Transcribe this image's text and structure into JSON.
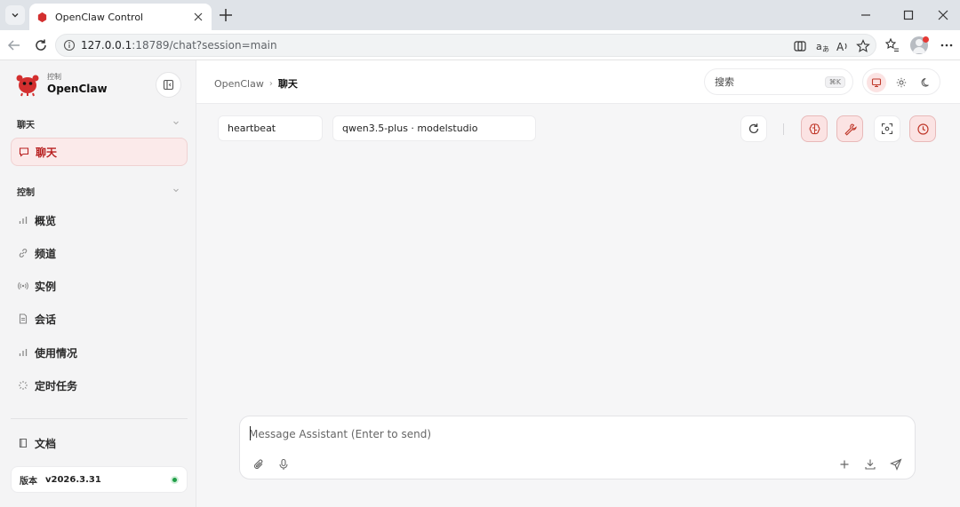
{
  "browser": {
    "tab_title": "OpenClaw Control",
    "url_host": "127.0.0.1",
    "url_rest": ":18789/chat?session=main"
  },
  "sidebar": {
    "brand_sub": "控制",
    "brand_name": "OpenClaw",
    "section_chat": "聊天",
    "active_item": "聊天",
    "section_control": "控制",
    "items": [
      {
        "label": "概览",
        "icon": "bar-chart-icon"
      },
      {
        "label": "频道",
        "icon": "link-icon"
      },
      {
        "label": "实例",
        "icon": "broadcast-icon"
      },
      {
        "label": "会话",
        "icon": "document-icon"
      },
      {
        "label": "使用情况",
        "icon": "bar-chart-icon"
      },
      {
        "label": "定时任务",
        "icon": "loader-icon"
      }
    ],
    "docs_label": "文档",
    "version_key": "版本",
    "version_value": "v2026.3.31"
  },
  "header": {
    "breadcrumb_root": "OpenClaw",
    "breadcrumb_sep": "›",
    "breadcrumb_current": "聊天",
    "search_placeholder": "搜索",
    "search_shortcut": "⌘K"
  },
  "toolbar": {
    "session_chip": "heartbeat",
    "model_chip": "qwen3.5-plus · modelstudio"
  },
  "composer": {
    "placeholder": "Message Assistant (Enter to send)"
  },
  "colors": {
    "accent": "#c0392b",
    "active_bg": "#fbeaea",
    "status_ok": "#1f9d47"
  }
}
